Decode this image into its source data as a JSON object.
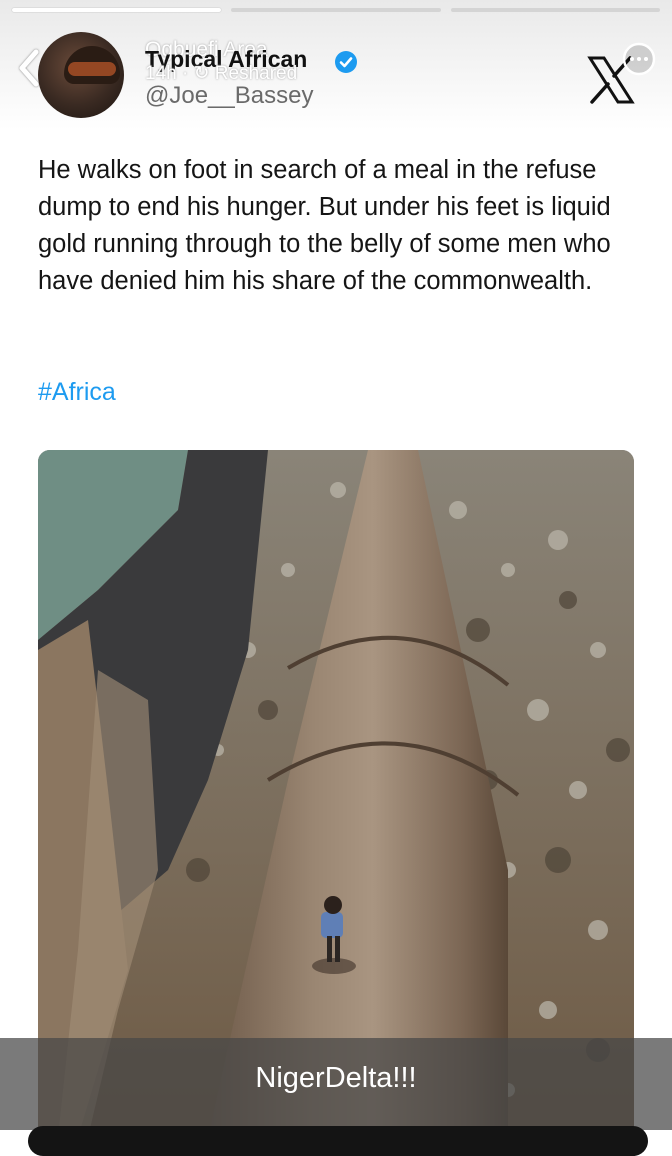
{
  "story": {
    "progress_segments": [
      {
        "state": "done"
      },
      {
        "state": "pending"
      },
      {
        "state": "pending"
      }
    ],
    "reshared_by": "Ogbuefi Area",
    "reshared_label": "Reshared",
    "time_ago": "14h",
    "caption": "NigerDelta!!!"
  },
  "tweet": {
    "display_name": "Typical African",
    "handle": "@Joe__Bassey",
    "verified": true,
    "text": "He walks on foot in search of a meal in the refuse dump to end his hunger. But under his feet is liquid gold running through to the belly of some men who have denied him his share of the commonwealth.",
    "hashtag": "#Africa"
  },
  "icons": {
    "back": "chevron-left-icon",
    "verified": "verified-badge-icon",
    "brand": "x-logo-icon",
    "more": "more-options-icon"
  },
  "colors": {
    "hashtag": "#1d9bf0",
    "verified": "#1d9bf0",
    "text": "#151515",
    "handle": "#6a6a6a"
  }
}
